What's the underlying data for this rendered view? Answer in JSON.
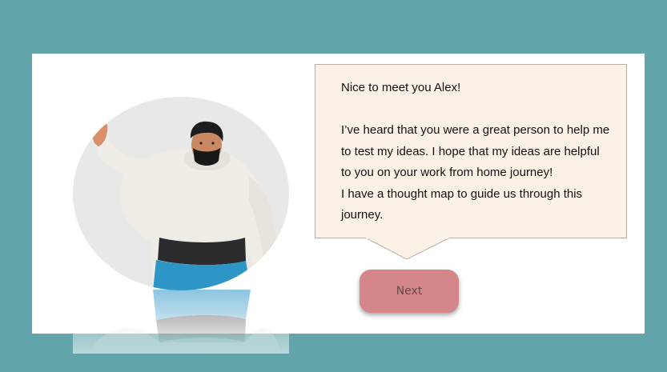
{
  "colors": {
    "background": "#62a6ab",
    "panel": "#ffffff",
    "bubble_fill": "#fcf1e6",
    "button": "#d4878a"
  },
  "dialog": {
    "greeting": "Nice to meet you Alex!",
    "paragraph_1": "I’ve heard that you were a great person to help me to test my ideas. I hope that my ideas are helpful to you on your work from home journey!",
    "paragraph_2": "I have a thought map to guide us through this journey."
  },
  "actions": {
    "next_label": "Next"
  },
  "icons": {
    "avatar": "character-avatar-icon"
  }
}
